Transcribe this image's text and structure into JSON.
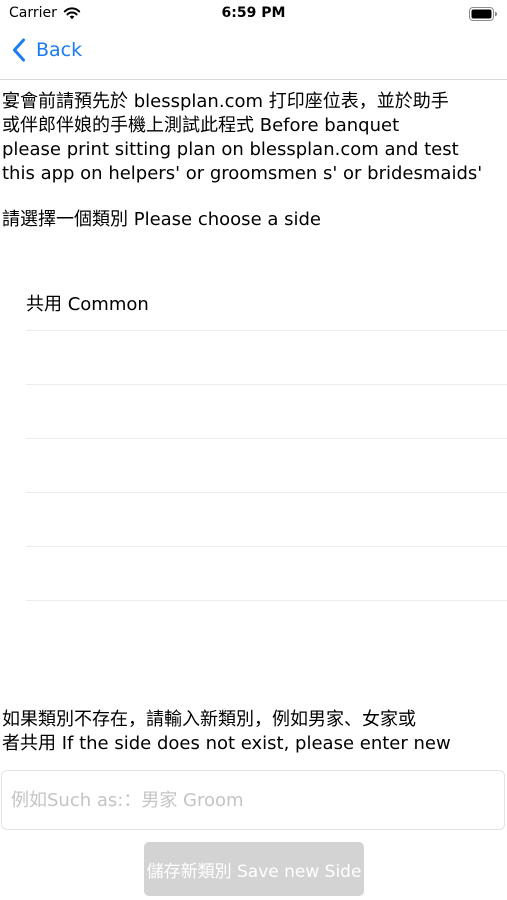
{
  "status_bar": {
    "carrier": "Carrier",
    "time": "6:59 PM",
    "icons": [
      "wifi-icon",
      "battery-icon"
    ]
  },
  "nav": {
    "back_label": "Back",
    "accent_color": "#1a7cf5"
  },
  "intro": {
    "text": "宴會前請預先於 blessplan.com 打印座位表，並於助手\n或伴郎伴娘的手機上測試此程式 Before banquet\nplease print sitting plan on  blessplan.com and test\nthis app on helpers' or groomsmen s' or bridesmaids'"
  },
  "choose_label": "請選擇一個類別 Please choose a side",
  "sides": [
    {
      "label": "共用 Common"
    },
    {
      "label": ""
    },
    {
      "label": ""
    },
    {
      "label": ""
    },
    {
      "label": ""
    },
    {
      "label": ""
    },
    {
      "label": ""
    }
  ],
  "bottom_hint": "如果類別不存在，請輸入新類別，例如男家、女家或\n者共用  If the side does not exist, please enter new",
  "new_side_input": {
    "value": "",
    "placeholder": "例如Such as:：男家 Groom"
  },
  "save_button": {
    "label": "儲存新類別 Save new Side",
    "state": "disabled"
  }
}
